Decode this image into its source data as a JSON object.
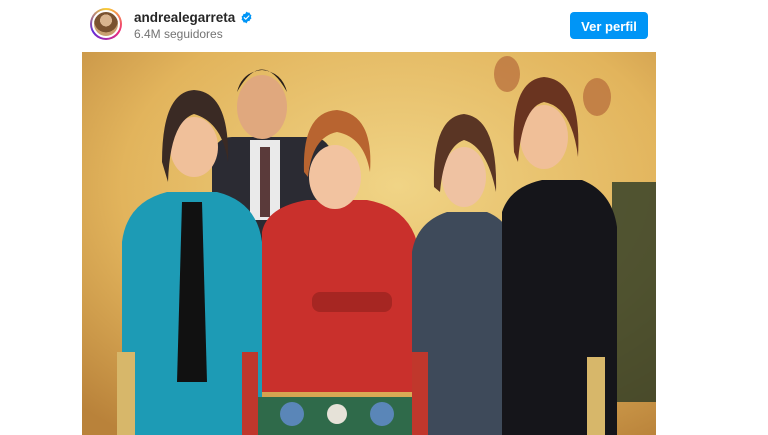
{
  "post": {
    "username": "andrealegarreta",
    "followers": "6.4M seguidores",
    "view_profile_label": "Ver perfil",
    "verified": true
  },
  "icons": {
    "avatar": "profile-avatar",
    "verified": "verified-badge-icon"
  },
  "colors": {
    "button": "#0095f6",
    "verified": "#0095f6"
  }
}
